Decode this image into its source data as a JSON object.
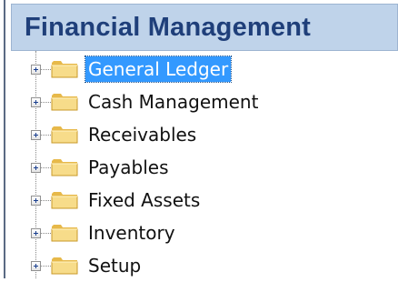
{
  "header": {
    "title": "Financial Management"
  },
  "tree": {
    "items": [
      {
        "label": "General Ledger",
        "selected": true
      },
      {
        "label": "Cash Management",
        "selected": false
      },
      {
        "label": "Receivables",
        "selected": false
      },
      {
        "label": "Payables",
        "selected": false
      },
      {
        "label": "Fixed Assets",
        "selected": false
      },
      {
        "label": "Inventory",
        "selected": false
      },
      {
        "label": "Setup",
        "selected": false
      }
    ]
  },
  "colors": {
    "header_background": "#bfd3ea",
    "header_text": "#1f3f7a",
    "selection": "#3399ff",
    "folder": "#f2d27a"
  },
  "icons": {
    "expander": "plus-box-icon",
    "node": "folder-icon"
  }
}
